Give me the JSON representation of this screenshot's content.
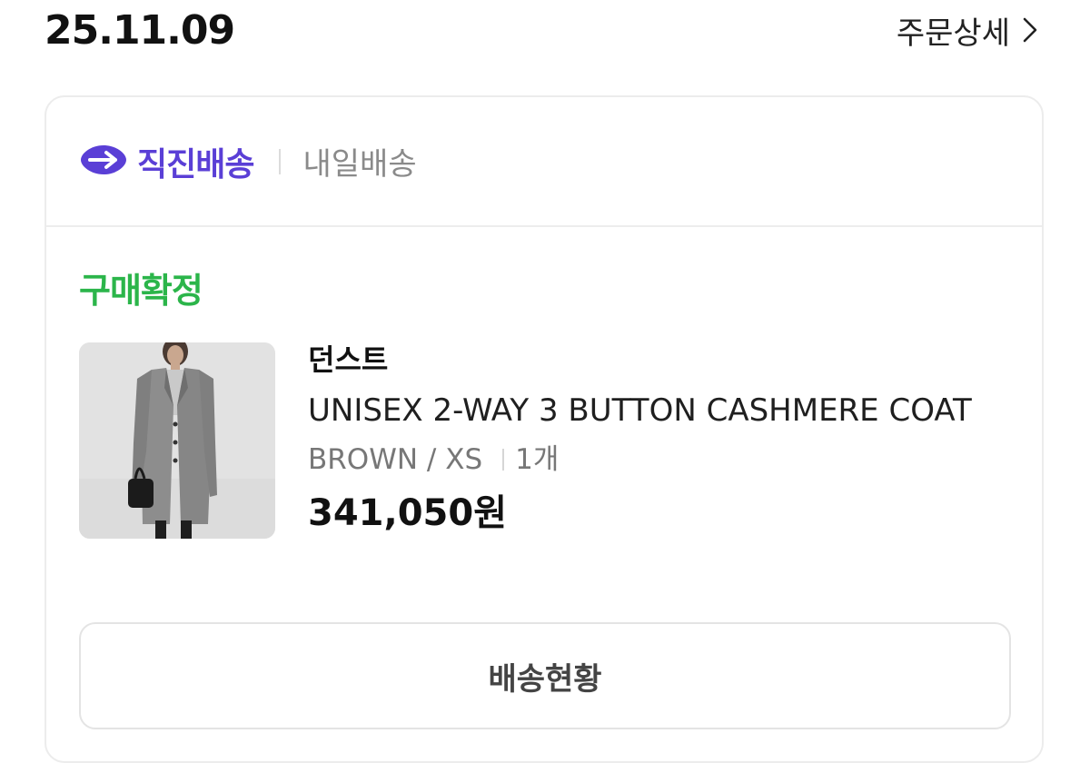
{
  "order": {
    "date": "25.11.09",
    "detail_label": "주문상세"
  },
  "card": {
    "brand_label": "직진배송",
    "brand_color": "#5a3fd6",
    "delivery_type": "내일배송",
    "status": "구매확정",
    "status_color": "#2bb54a"
  },
  "product": {
    "brand": "던스트",
    "name": "UNISEX 2-WAY 3 BUTTON CASHMERE COAT",
    "option": "BROWN / XS",
    "quantity": "1개",
    "price": "341,050원"
  },
  "actions": {
    "shipping_status_label": "배송현황"
  },
  "icons": {
    "detail": "chevron-right-icon",
    "brand": "direct-delivery-logo-icon"
  }
}
